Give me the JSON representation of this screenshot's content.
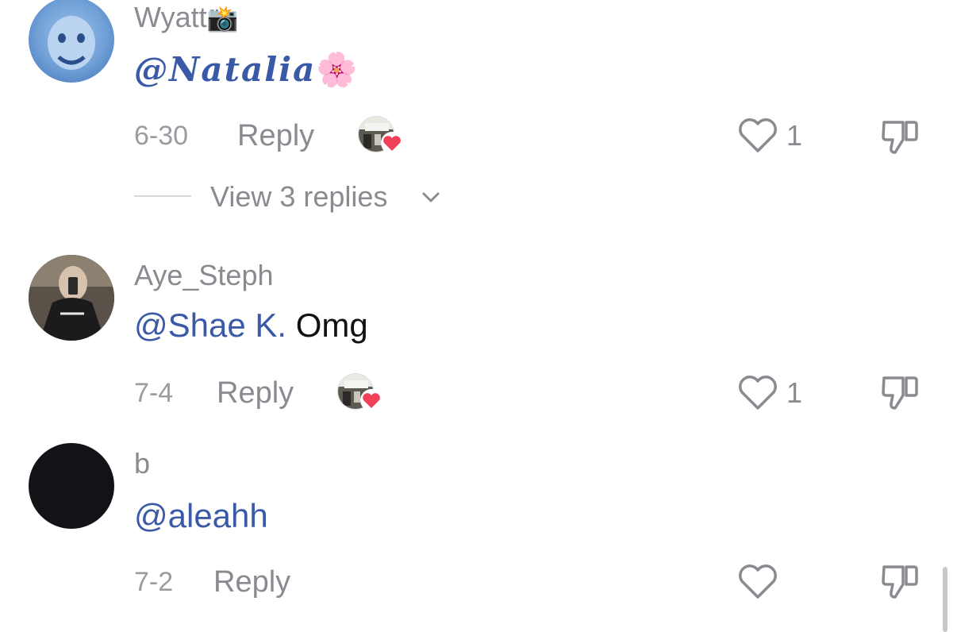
{
  "comments": [
    {
      "username": "Wyatt",
      "username_emoji": "📸",
      "mention": "@Natalia",
      "text": "",
      "text_emoji": "🌸",
      "date": "6-30",
      "reply_label": "Reply",
      "creator_liked": true,
      "like_count": "1",
      "view_replies_label": "View 3 replies"
    },
    {
      "username": "Aye_Steph",
      "mention": "@Shae K.",
      "text": " Omg",
      "date": "7-4",
      "reply_label": "Reply",
      "creator_liked": true,
      "like_count": "1"
    },
    {
      "username": "b",
      "mention": "@aleahh",
      "text": "",
      "date": "7-2",
      "reply_label": "Reply",
      "creator_liked": false,
      "like_count": ""
    }
  ],
  "icons": {
    "like": "heart-outline-icon",
    "dislike": "thumbs-down-icon",
    "creator_like_badge": "red-heart-icon",
    "expand": "chevron-down-icon"
  },
  "colors": {
    "mention": "#3a5aa8",
    "muted": "#8a8b91",
    "heart_badge": "#f0405a"
  }
}
